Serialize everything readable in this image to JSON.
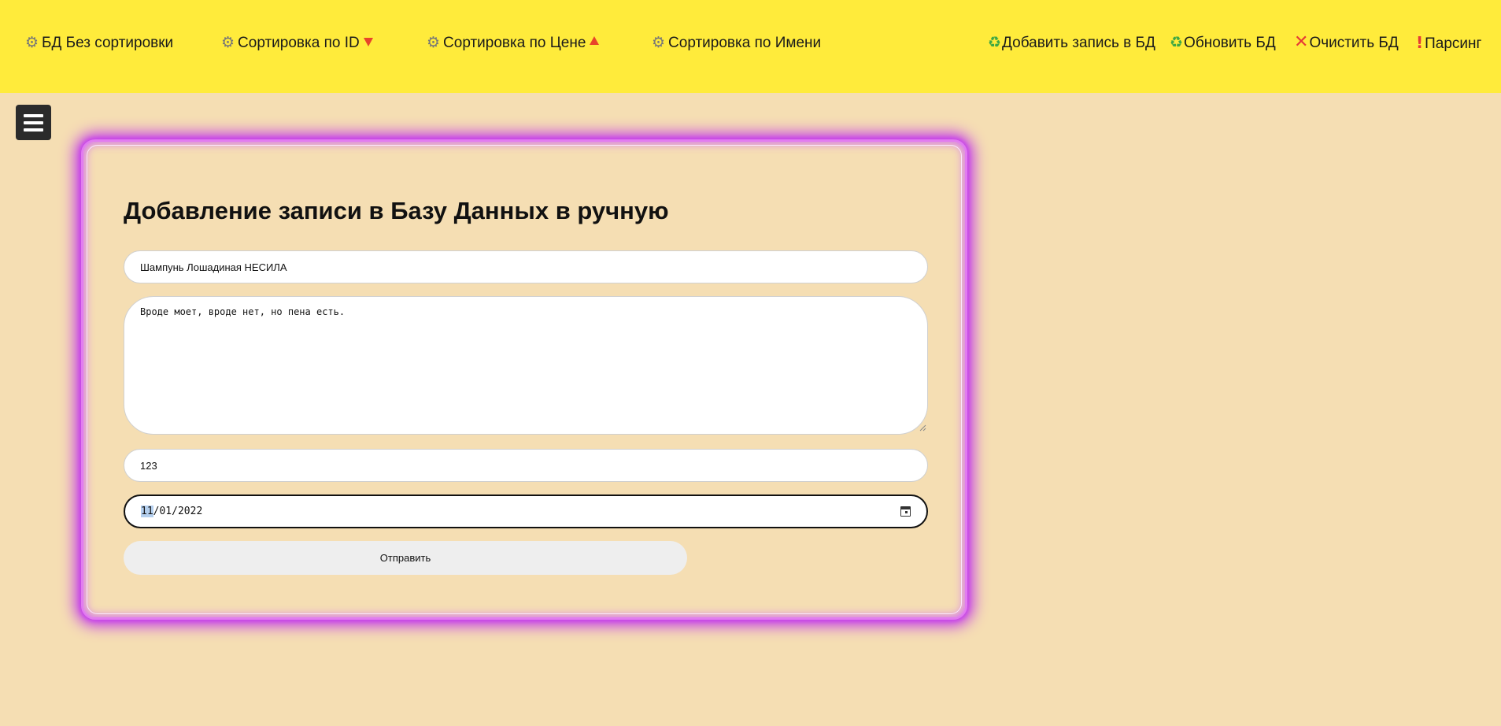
{
  "nav": {
    "items": [
      {
        "label": "БД Без сортировки",
        "icon": "gear-icon"
      },
      {
        "label": "Сортировка по ID",
        "icon": "gear-icon",
        "sort_indicator": "triangle-down-icon"
      },
      {
        "label": "Сортировка по Цене",
        "icon": "gear-icon",
        "sort_indicator": "triangle-up-icon"
      },
      {
        "label": "Сортировка по Имени",
        "icon": "gear-icon"
      }
    ],
    "actions": [
      {
        "label": "Добавить запись в БД",
        "icon": "recycle-icon"
      },
      {
        "label": "Обновить БД",
        "icon": "recycle-icon"
      },
      {
        "label": "Очистить БД",
        "icon": "cross-icon"
      },
      {
        "label": "Парсинг",
        "icon": "exclamation-icon"
      }
    ]
  },
  "menu": {
    "icon": "hamburger-menu-icon"
  },
  "form": {
    "title": "Добавление записи в Базу Данных в ручную",
    "name_value": "Шампунь Лошадиная НЕСИЛА",
    "description_value": "Вроде моет, вроде нет, но пена есть.",
    "price_value": "123",
    "date": {
      "month": "11",
      "rest": "/01/2022"
    },
    "submit_label": "Отправить"
  },
  "colors": {
    "topbar": "#ffeb3b",
    "background": "#f5deb3",
    "card_glow": "#c33de8",
    "sort_indicator": "#e8442a",
    "date_selection": "#b4cfee"
  }
}
